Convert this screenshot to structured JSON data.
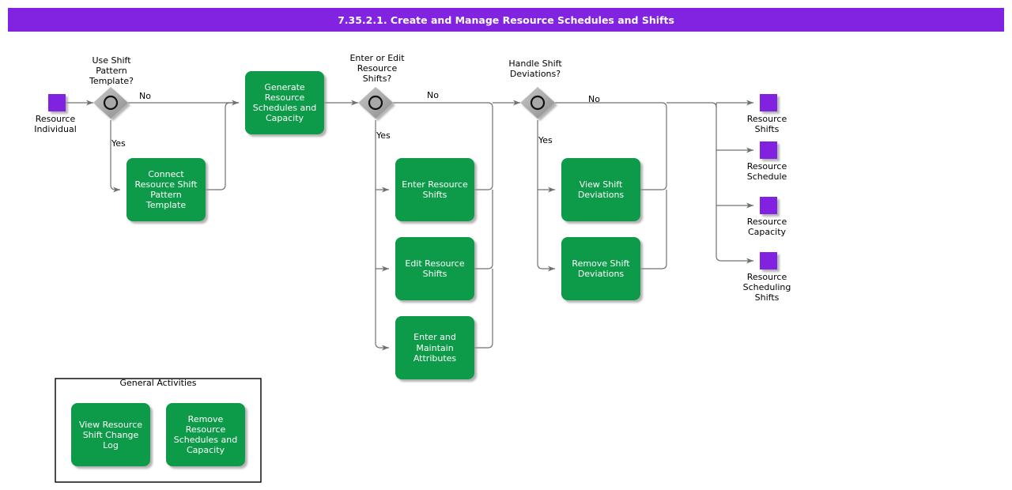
{
  "header": {
    "title": "7.35.2.1. Create and Manage Resource Schedules and Shifts",
    "bar_color": "#8223E2"
  },
  "colors": {
    "task_green": "#089B4A",
    "data_purple": "#8020E0",
    "gateway_gray": "#A6A6A6",
    "connector_gray": "#707070",
    "text_white": "#FFFFFF",
    "text_black": "#000000"
  },
  "start_node": {
    "name": "Resource Individual",
    "label_line1": "Resource",
    "label_line2": "Individual"
  },
  "gateways": [
    {
      "id": "gw1",
      "question_line1": "Use Shift",
      "question_line2": "Pattern",
      "question_line3": "Template?",
      "yes_label": "Yes",
      "no_label": "No"
    },
    {
      "id": "gw2",
      "question_line1": "Enter or Edit",
      "question_line2": "Resource",
      "question_line3": "Shifts?",
      "yes_label": "Yes",
      "no_label": "No"
    },
    {
      "id": "gw3",
      "question_line1": "Handle Shift",
      "question_line2": "Deviations?",
      "question_line3": "",
      "yes_label": "Yes",
      "no_label": "No"
    }
  ],
  "tasks": [
    {
      "id": "connect-resource-shift-pattern-template",
      "lines": [
        "Connect",
        "Resource Shift",
        "Pattern",
        "Template"
      ]
    },
    {
      "id": "generate-resource-schedules-and-capacity",
      "lines": [
        "Generate",
        "Resource",
        "Schedules and",
        "Capacity"
      ]
    },
    {
      "id": "enter-resource-shifts",
      "lines": [
        "Enter Resource",
        "Shifts"
      ]
    },
    {
      "id": "edit-resource-shifts",
      "lines": [
        "Edit Resource",
        "Shifts"
      ]
    },
    {
      "id": "enter-and-maintain-attributes",
      "lines": [
        "Enter and",
        "Maintain",
        "Attributes"
      ]
    },
    {
      "id": "view-shift-deviations",
      "lines": [
        "View Shift",
        "Deviations"
      ]
    },
    {
      "id": "remove-shift-deviations",
      "lines": [
        "Remove Shift",
        "Deviations"
      ]
    }
  ],
  "outputs": [
    {
      "id": "resource-shifts",
      "lines": [
        "Resource",
        "Shifts"
      ]
    },
    {
      "id": "resource-schedule",
      "lines": [
        "Resource",
        "Schedule"
      ]
    },
    {
      "id": "resource-capacity",
      "lines": [
        "Resource",
        "Capacity"
      ]
    },
    {
      "id": "resource-scheduling-shifts",
      "lines": [
        "Resource",
        "Scheduling",
        "Shifts"
      ]
    }
  ],
  "general_activities": {
    "title": "General Activities",
    "tasks": [
      {
        "id": "view-resource-shift-change-log",
        "lines": [
          "View Resource",
          "Shift Change",
          "Log"
        ]
      },
      {
        "id": "remove-resource-schedules-and-capacity",
        "lines": [
          "Remove",
          "Resource",
          "Schedules and",
          "Capacity"
        ]
      }
    ]
  }
}
